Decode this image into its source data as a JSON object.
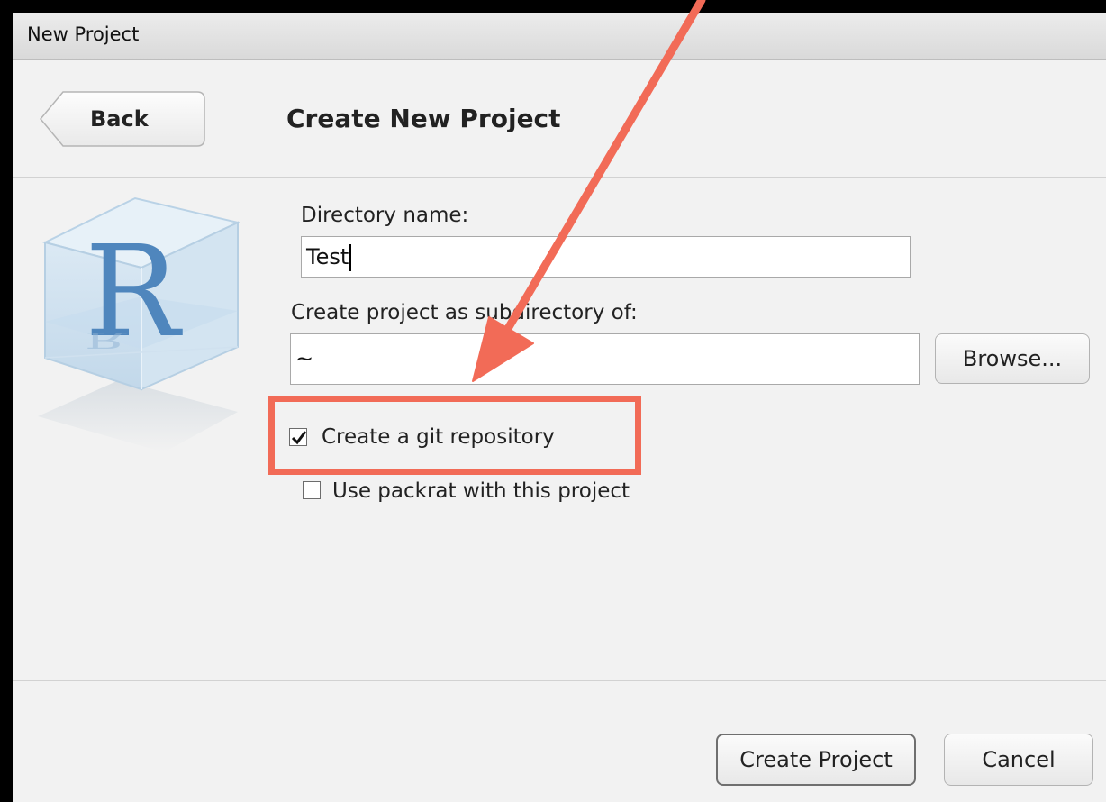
{
  "window": {
    "title": "New Project"
  },
  "header": {
    "back_label": "Back",
    "title": "Create New Project"
  },
  "logo": {
    "letter": "R"
  },
  "form": {
    "directory_label": "Directory name:",
    "directory_value": "Test",
    "parent_label": "Create project as subdirectory of:",
    "parent_value": "~",
    "browse_label": "Browse...",
    "git_label": "Create a git repository",
    "git_checked": true,
    "packrat_label": "Use packrat with this project",
    "packrat_checked": false
  },
  "footer": {
    "create_label": "Create Project",
    "cancel_label": "Cancel"
  },
  "annotation": {
    "color": "#f26b57"
  }
}
